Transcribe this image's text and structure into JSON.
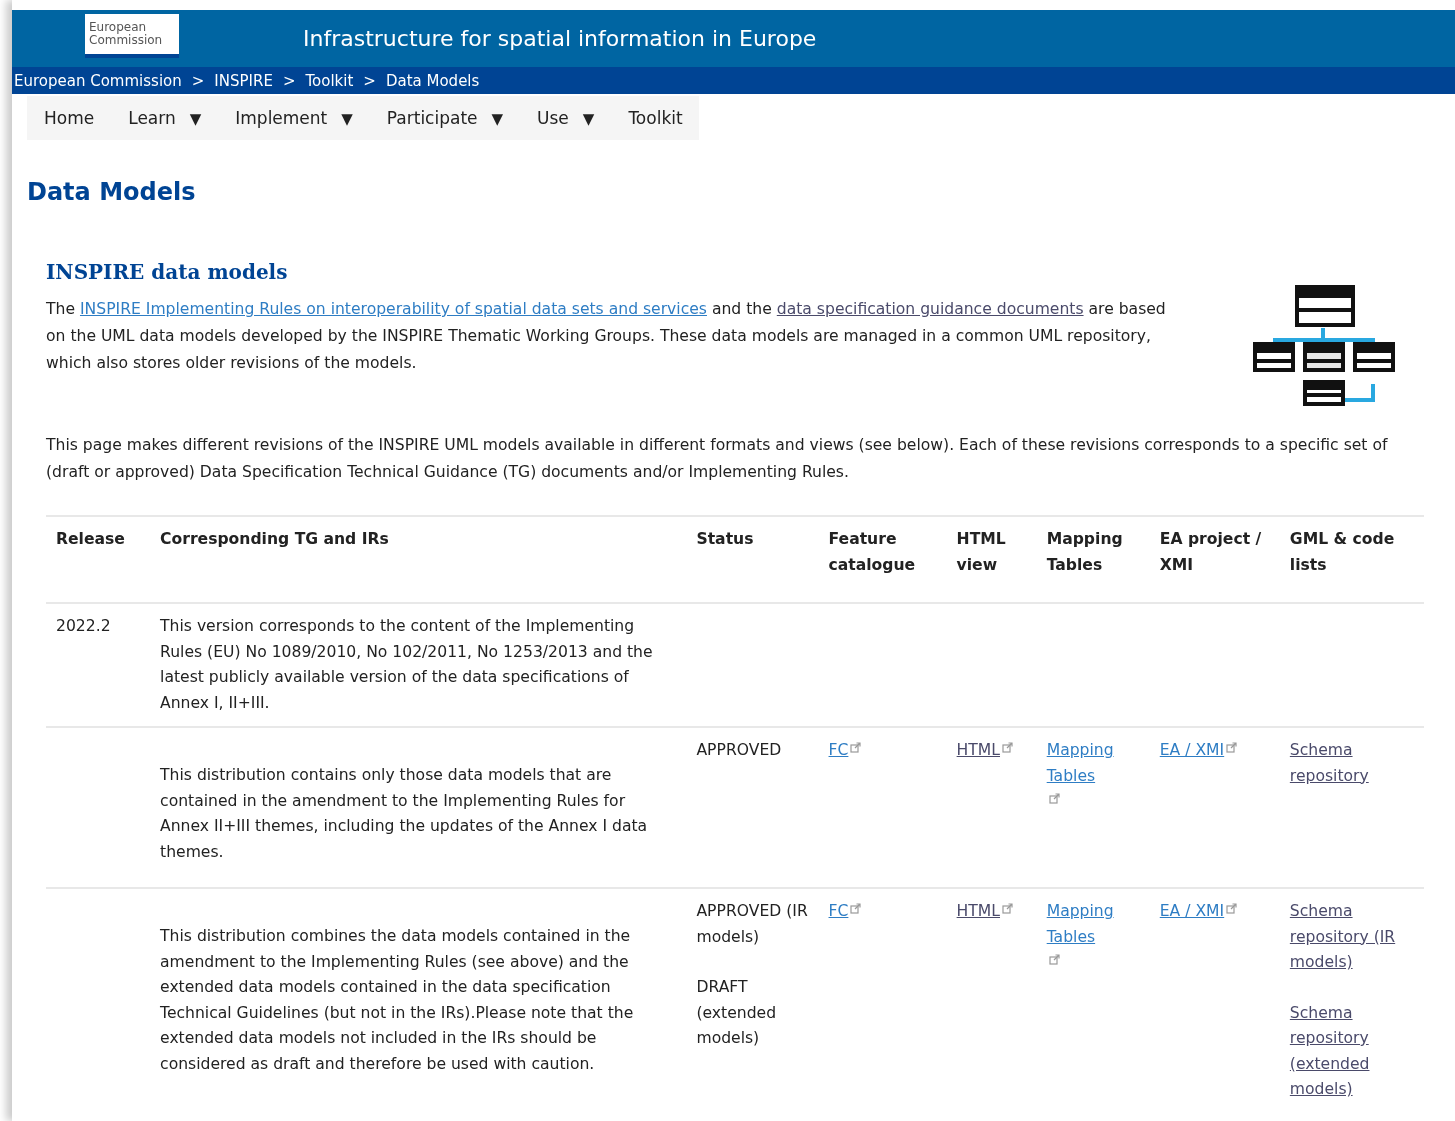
{
  "header": {
    "logo_lines": [
      "European",
      "Commission"
    ],
    "title": "Infrastructure for spatial information in Europe"
  },
  "breadcrumb": [
    "European Commission",
    "INSPIRE",
    "Toolkit",
    "Data Models"
  ],
  "breadcrumb_separator": ">",
  "nav": [
    {
      "label": "Home",
      "dropdown": false
    },
    {
      "label": "Learn",
      "dropdown": true
    },
    {
      "label": "Implement",
      "dropdown": true
    },
    {
      "label": "Participate",
      "dropdown": true
    },
    {
      "label": "Use",
      "dropdown": true
    },
    {
      "label": "Toolkit",
      "dropdown": false
    }
  ],
  "nav_caret": "▼",
  "page_title": "Data Models",
  "section_title": "INSPIRE data models",
  "intro": [
    {
      "text": "The "
    },
    {
      "link": "INSPIRE Implementing Rules on interoperability of spatial data sets and services",
      "visited": false
    },
    {
      "text": "  and the "
    },
    {
      "link": "data specification guidance documents",
      "visited": true
    },
    {
      "text": " are based on the UML data models developed by the INSPIRE Thematic Working Groups. These data models are managed in a common UML repository, which also stores older revisions of the models."
    }
  ],
  "paragraph": "This page makes different revisions of the INSPIRE UML models available in different formats and views (see below). Each of these revisions corresponds to a specific set of (draft or approved) Data Specification Technical Guidance (TG) documents and/or Implementing Rules.",
  "table": {
    "columns": [
      "Release",
      "Corresponding TG and IRs",
      "Status",
      "Feature catalogue",
      "HTML view",
      "Mapping Tables",
      "EA project / XMI",
      "GML & code lists"
    ],
    "rows": [
      {
        "release": "2022.2",
        "description": "This version corresponds to the content of the Implementing Rules (EU) No 1089/2010, No 102/2011, No 1253/2013 and the latest publicly available version of the data specifications of Annex I, II+III.",
        "status": []
      },
      {
        "release": "",
        "description": "This distribution contains only those data models that are contained in the amendment to the Implementing Rules for Annex II+III themes, including the updates of the Annex I data themes.",
        "status": [
          "APPROVED"
        ],
        "links": [
          [
            {
              "label": "FC",
              "visited": false,
              "external": true
            }
          ],
          [
            {
              "label": "HTML",
              "visited": true,
              "external": true
            }
          ],
          [
            {
              "label": "Mapping Tables",
              "visited": false,
              "external": true
            }
          ],
          [
            {
              "label": "EA / XMI",
              "visited": false,
              "external": true
            }
          ],
          [
            {
              "label": "Schema repository",
              "visited": true,
              "external": false
            }
          ]
        ]
      },
      {
        "release": "",
        "description": "This distribution combines the data models contained in the amendment to the Implementing Rules (see above) and the extended data models contained in the data specification Technical Guidelines (but not in the IRs).Please note that the extended data models not included in the IRs should be considered as draft and therefore be used with caution.",
        "status": [
          "APPROVED (IR models)",
          "DRAFT (extended models)"
        ],
        "links": [
          [
            {
              "label": "FC",
              "visited": false,
              "external": true
            }
          ],
          [
            {
              "label": "HTML",
              "visited": true,
              "external": true
            }
          ],
          [
            {
              "label": "Mapping Tables",
              "visited": false,
              "external": true
            }
          ],
          [
            {
              "label": "EA / XMI",
              "visited": false,
              "external": true
            }
          ],
          [
            {
              "label": "Schema repository (IR models)",
              "visited": true,
              "external": false
            },
            {
              "label": "Schema repository (extended models)",
              "visited": true,
              "external": false
            }
          ]
        ]
      }
    ]
  }
}
